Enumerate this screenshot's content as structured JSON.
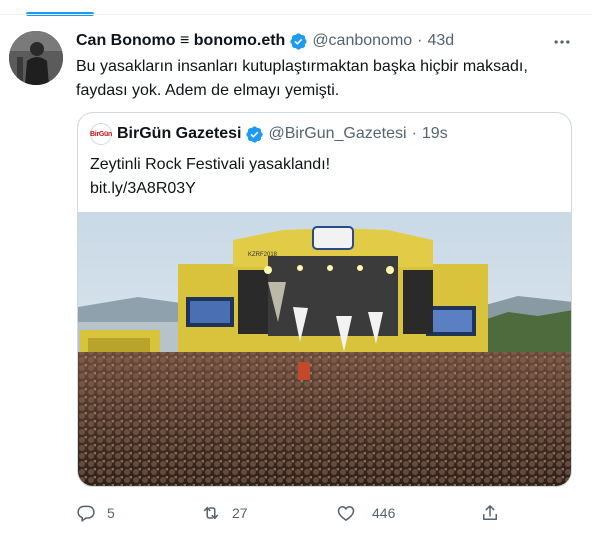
{
  "tweet": {
    "author_name": "Can Bonomo ≡ bonomo.eth",
    "handle": "@canbonomo",
    "separator": "·",
    "time": "43d",
    "text": "Bu yasakların insanları kutuplaştırmaktan başka hiçbir maksadı, faydası yok. Adem de elmayı yemişti."
  },
  "quote": {
    "avatar_text": "BirGün",
    "author_name": "BirGün Gazetesi",
    "handle": "@BirGun_Gazetesi",
    "separator": "·",
    "time": "19s",
    "line1": "Zeytinli Rock Festivali yasaklandı!",
    "line2": "bit.ly/3A8R03Y",
    "stage_banner": "KZRF2018"
  },
  "actions": {
    "replies": "5",
    "retweets": "27",
    "likes": "446"
  },
  "icons": {
    "verified": "verified-badge-icon",
    "more": "more-icon",
    "reply": "reply-icon",
    "retweet": "retweet-icon",
    "like": "like-icon",
    "share": "share-icon"
  },
  "colors": {
    "accent": "#1d9bf0",
    "text": "#0f1419",
    "secondary": "#536471",
    "border": "#cfd9de"
  }
}
